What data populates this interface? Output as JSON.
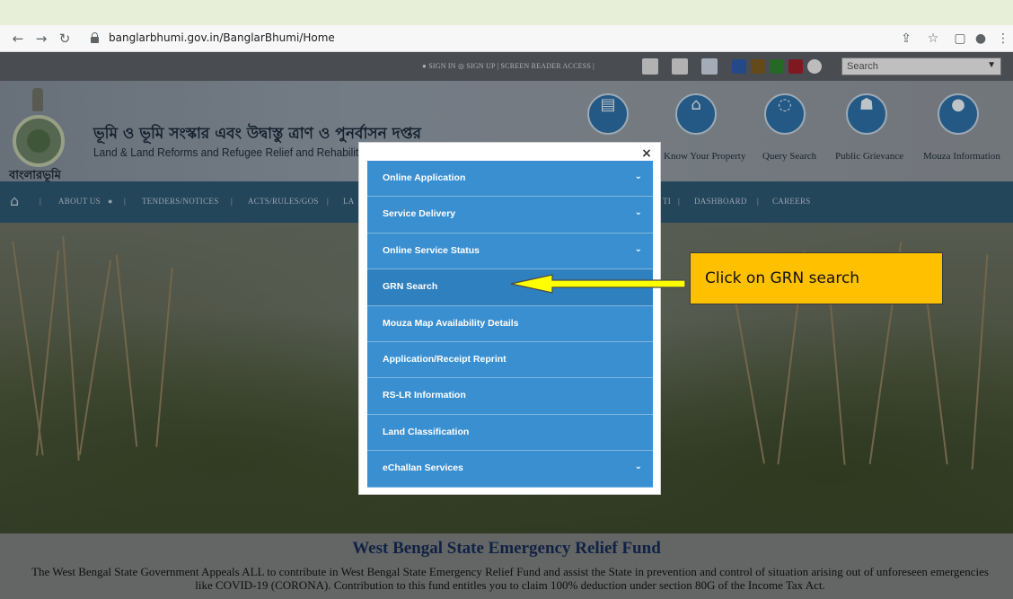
{
  "browser": {
    "url": "banglarbhumi.gov.in/BanglarBhumi/Home"
  },
  "utility": {
    "links": "● SIGN IN  ◎ SIGN UP | SCREEN READER ACCESS |",
    "search_placeholder": "Search"
  },
  "header": {
    "title_bengali": "ভূমি ও ভূমি সংস্কার এবং উদ্বাস্তু ত্রাণ ও পুনর্বাসন দপ্তর",
    "title_english": "Land & Land Reforms and Refugee Relief and Rehabilitation Department",
    "brand": "বাংলারভূমি",
    "quick_links": [
      "Know Your Property",
      "Query Search",
      "Public Grievance",
      "Mouza Information"
    ]
  },
  "nav": {
    "items": [
      "ABOUT US",
      "TENDERS/NOTICES",
      "ACTS/RULES/GOS",
      "LA",
      "TI",
      "DASHBOARD",
      "CAREERS"
    ]
  },
  "fund": {
    "title": "West Bengal State Emergency Relief Fund",
    "text": "The West Bengal State Government Appeals ALL to contribute in West Bengal State Emergency Relief Fund and assist the State in prevention and control of situation arising out of unforeseen emergencies like COVID-19 (CORONA). Contribution to this fund entitles you to claim 100% deduction under section 80G of the Income Tax Act."
  },
  "modal": {
    "close": "×",
    "items": [
      {
        "label": "Online Application",
        "chevron": "⌄"
      },
      {
        "label": "Service Delivery",
        "chevron": "⌄"
      },
      {
        "label": "Online Service Status",
        "chevron": "⌄"
      },
      {
        "label": "GRN Search",
        "chevron": ""
      },
      {
        "label": "Mouza Map Availability Details",
        "chevron": ""
      },
      {
        "label": "Application/Receipt Reprint",
        "chevron": ""
      },
      {
        "label": "RS-LR Information",
        "chevron": ""
      },
      {
        "label": "Land Classification",
        "chevron": ""
      },
      {
        "label": "eChallan Services",
        "chevron": "⌄"
      }
    ]
  },
  "annotation": {
    "text": "Click on GRN search"
  },
  "colors": {
    "menu_item": "#3a8fd0",
    "callout": "#ffc000",
    "arrow": "#ffff00"
  }
}
